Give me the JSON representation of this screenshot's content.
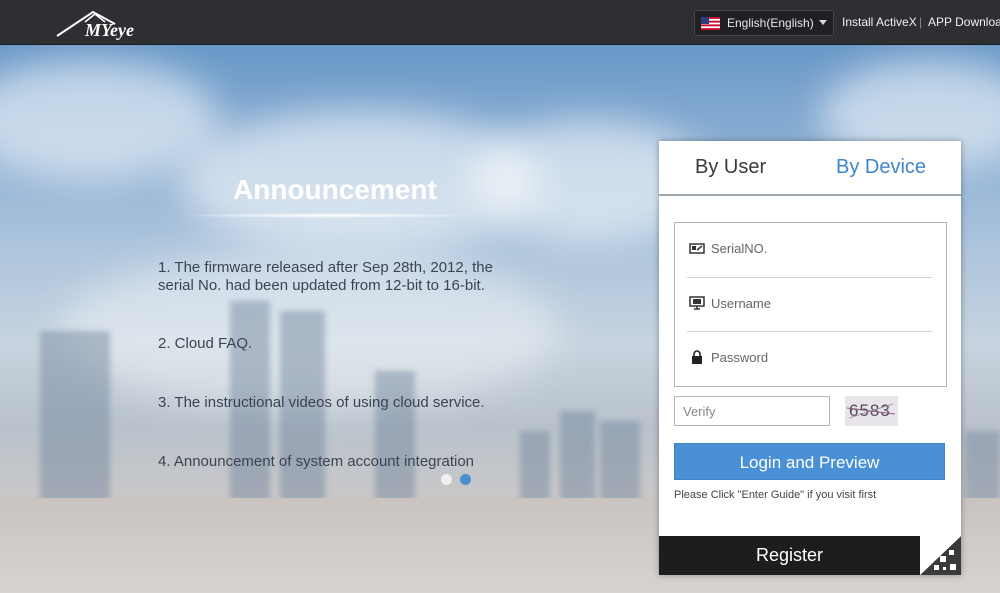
{
  "header": {
    "logo_text": "MYeye",
    "language": {
      "selected": "English(English)",
      "flag_icon": "us-flag-icon"
    },
    "links": [
      "Install ActiveX",
      "APP Download"
    ],
    "separator": "|"
  },
  "announcement": {
    "title": "Announcement",
    "items": [
      "1. The firmware released after Sep 28th, 2012, the serial No. had been updated from 12-bit to 16-bit.",
      "2. Cloud FAQ.",
      "3. The instructional videos of using cloud service.",
      "4. Announcement of system account integration"
    ],
    "carousel_active_index": 1
  },
  "login": {
    "tabs": [
      {
        "label": "By User",
        "active": false
      },
      {
        "label": "By Device",
        "active": true
      }
    ],
    "fields": {
      "serial_placeholder": "SerialNO.",
      "username_placeholder": "Username",
      "password_placeholder": "Password",
      "verify_placeholder": "Verify"
    },
    "captcha": "6583",
    "login_button": "Login and Preview",
    "hint": "Please Click \"Enter Guide\" if you visit first",
    "register_button": "Register"
  },
  "colors": {
    "accent": "#4a90d6",
    "tab_active": "#3f86c9",
    "tab_inactive": "#3a3a3a",
    "topbar": "#2e2f33"
  }
}
